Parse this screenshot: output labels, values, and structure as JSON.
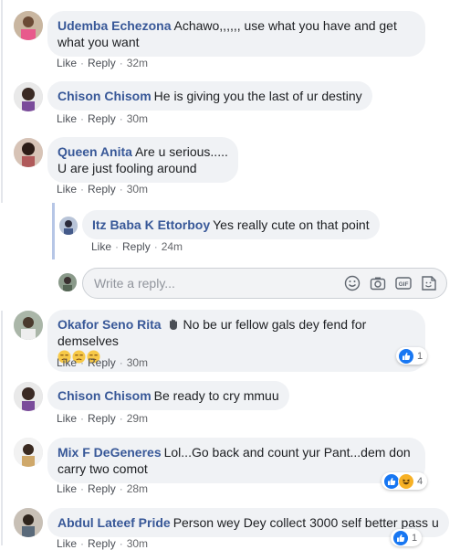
{
  "labels": {
    "like": "Like",
    "reply": "Reply",
    "sep": "·"
  },
  "comments": [
    {
      "name": "Udemba Echezona",
      "text": "Achawo,,,,,, use what you have and get what you want",
      "time": "32m"
    },
    {
      "name": "Chison Chisom",
      "text": "He is giving you the last of ur destiny",
      "time": "30m"
    },
    {
      "name": "Queen Anita",
      "text": "Are u serious.....",
      "text2": "U are just fooling around",
      "time": "30m"
    },
    {
      "name": "Itz Baba K Ettorboy",
      "text": "Yes really cute on that point",
      "time": "24m"
    },
    {
      "name": "Okafor Seno Rita",
      "text": "No be ur fellow gals dey fend for demselves",
      "time": "30m",
      "reaction_count": "1",
      "reactions": [
        "like"
      ]
    },
    {
      "name": "Chison Chisom",
      "text": "Be ready to cry mmuu",
      "time": "29m"
    },
    {
      "name": "Mix F DeGeneres",
      "text": "Lol...Go back and count yur Pant...dem don carry two comot",
      "time": "28m",
      "reaction_count": "4",
      "reactions": [
        "like",
        "haha"
      ]
    },
    {
      "name": "Abdul Lateef Pride",
      "text": "Person wey Dey collect 3000 self better pass u",
      "time": "30m",
      "reaction_count": "1",
      "reactions": [
        "like"
      ]
    }
  ],
  "reply_box": {
    "placeholder": "Write a reply..."
  },
  "icons": [
    "emoji-icon",
    "camera-icon",
    "gif-icon",
    "sticker-icon"
  ],
  "colors": {
    "name": "#385898",
    "bubble": "#f0f2f5",
    "like": "#1877f2",
    "haha": "#f7b125"
  }
}
